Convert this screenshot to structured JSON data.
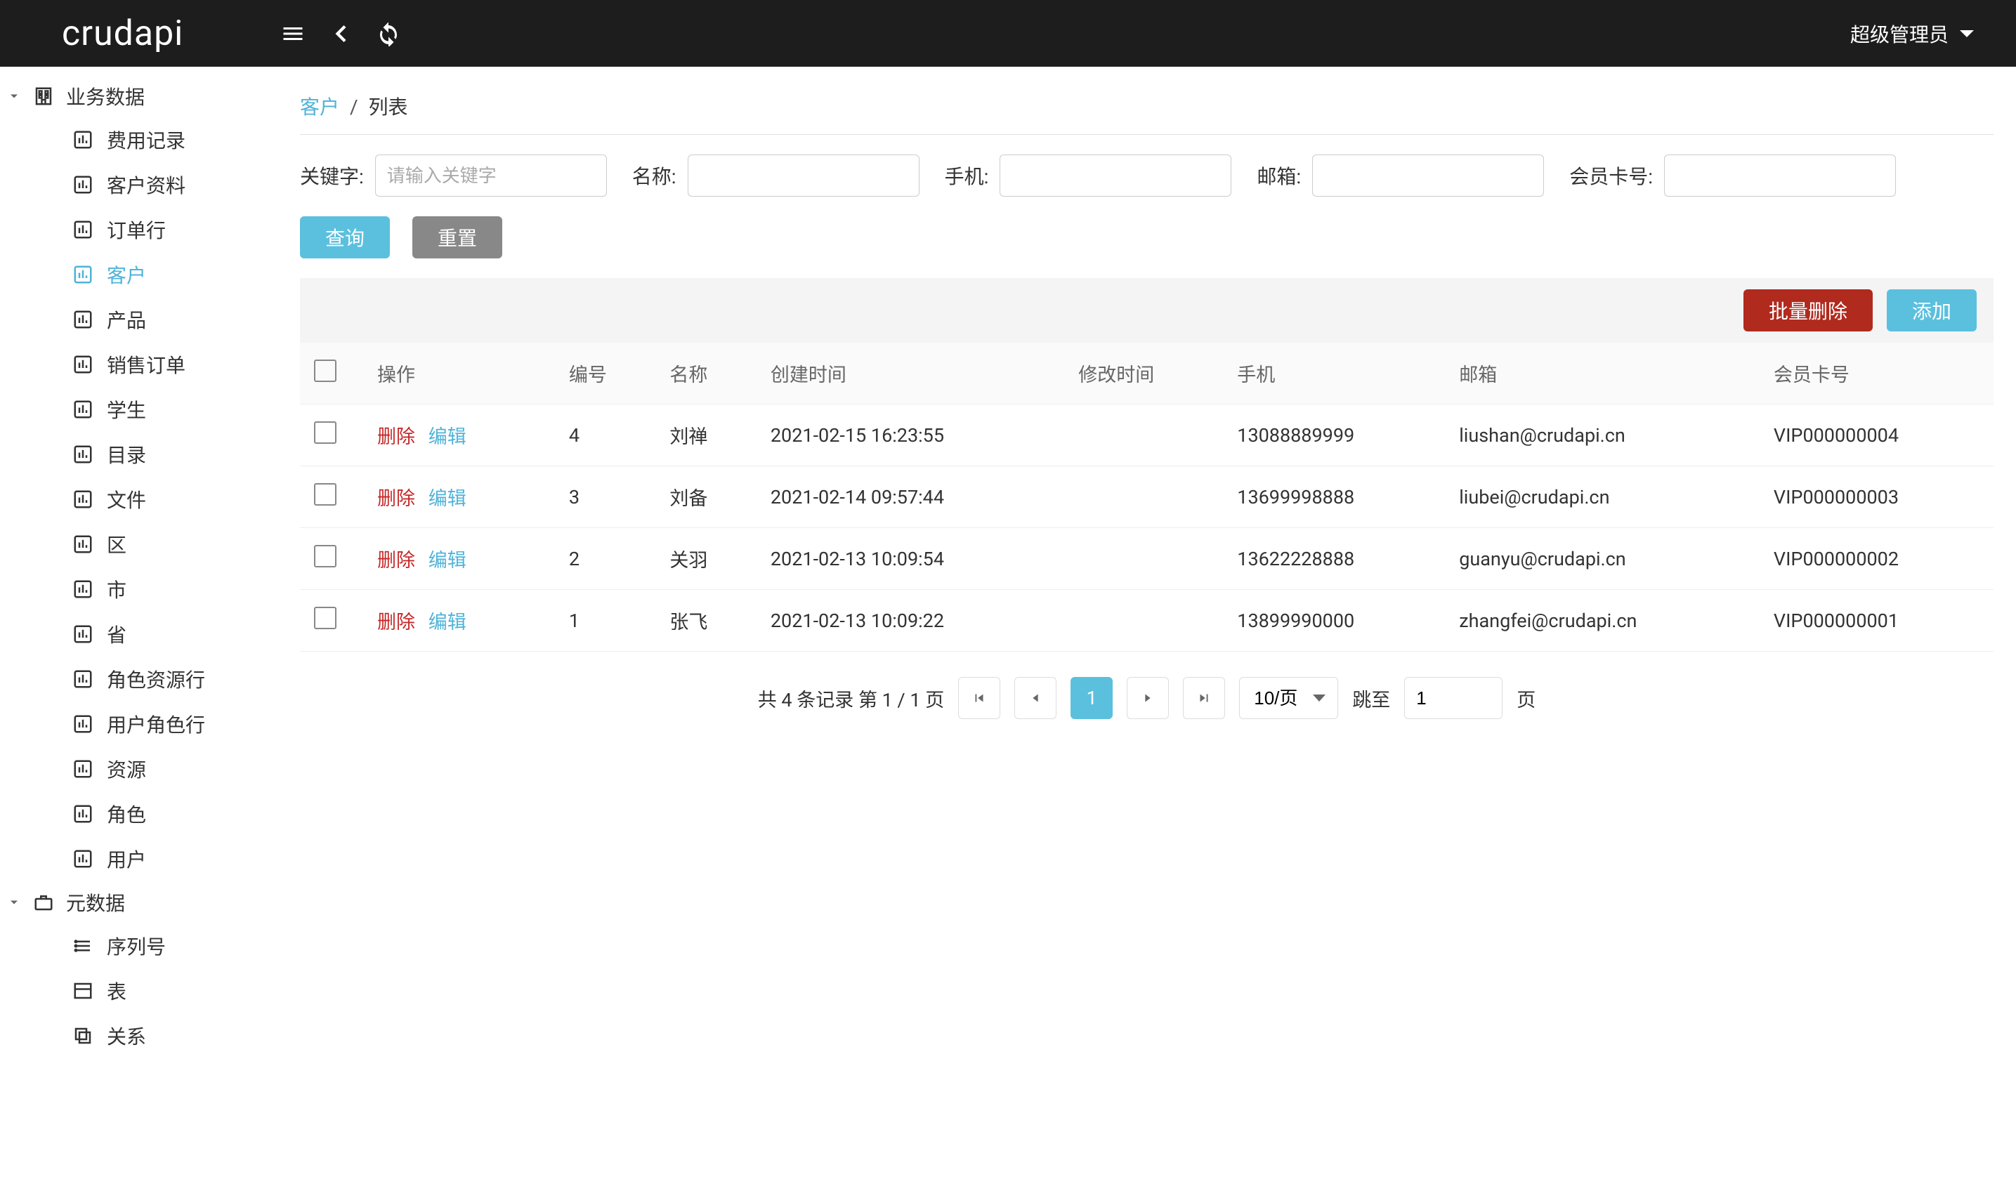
{
  "header": {
    "logo": "crudapi",
    "user": "超级管理员"
  },
  "sidebar": {
    "groups": [
      {
        "label": "业务数据",
        "icon": "building-icon",
        "expanded": true,
        "childIcon": "chart-icon",
        "children": [
          {
            "label": "费用记录",
            "active": false
          },
          {
            "label": "客户资料",
            "active": false
          },
          {
            "label": "订单行",
            "active": false
          },
          {
            "label": "客户",
            "active": true
          },
          {
            "label": "产品",
            "active": false
          },
          {
            "label": "销售订单",
            "active": false
          },
          {
            "label": "学生",
            "active": false
          },
          {
            "label": "目录",
            "active": false
          },
          {
            "label": "文件",
            "active": false
          },
          {
            "label": "区",
            "active": false
          },
          {
            "label": "市",
            "active": false
          },
          {
            "label": "省",
            "active": false
          },
          {
            "label": "角色资源行",
            "active": false
          },
          {
            "label": "用户角色行",
            "active": false
          },
          {
            "label": "资源",
            "active": false
          },
          {
            "label": "角色",
            "active": false
          },
          {
            "label": "用户",
            "active": false
          }
        ]
      },
      {
        "label": "元数据",
        "icon": "briefcase-icon",
        "expanded": true,
        "children": [
          {
            "label": "序列号",
            "icon": "list-icon",
            "active": false
          },
          {
            "label": "表",
            "icon": "table-icon",
            "active": false
          },
          {
            "label": "关系",
            "icon": "copy-icon",
            "active": false
          }
        ]
      }
    ]
  },
  "breadcrumb": {
    "link": "客户",
    "current": "列表"
  },
  "search": {
    "fields": [
      {
        "label": "关键字:",
        "placeholder": "请输入关键字",
        "value": ""
      },
      {
        "label": "名称:",
        "placeholder": "",
        "value": ""
      },
      {
        "label": "手机:",
        "placeholder": "",
        "value": ""
      },
      {
        "label": "邮箱:",
        "placeholder": "",
        "value": ""
      },
      {
        "label": "会员卡号:",
        "placeholder": "",
        "value": ""
      }
    ],
    "queryBtn": "查询",
    "resetBtn": "重置"
  },
  "toolbar": {
    "bulkDelete": "批量删除",
    "add": "添加"
  },
  "table": {
    "columns": [
      "",
      "操作",
      "编号",
      "名称",
      "创建时间",
      "修改时间",
      "手机",
      "邮箱",
      "会员卡号"
    ],
    "actions": {
      "delete": "删除",
      "edit": "编辑"
    },
    "rows": [
      {
        "id": "4",
        "name": "刘禅",
        "created": "2021-02-15 16:23:55",
        "modified": "",
        "phone": "13088889999",
        "email": "liushan@crudapi.cn",
        "card": "VIP000000004"
      },
      {
        "id": "3",
        "name": "刘备",
        "created": "2021-02-14 09:57:44",
        "modified": "",
        "phone": "13699998888",
        "email": "liubei@crudapi.cn",
        "card": "VIP000000003"
      },
      {
        "id": "2",
        "name": "关羽",
        "created": "2021-02-13 10:09:54",
        "modified": "",
        "phone": "13622228888",
        "email": "guanyu@crudapi.cn",
        "card": "VIP000000002"
      },
      {
        "id": "1",
        "name": "张飞",
        "created": "2021-02-13 10:09:22",
        "modified": "",
        "phone": "13899990000",
        "email": "zhangfei@crudapi.cn",
        "card": "VIP000000001"
      }
    ]
  },
  "pagination": {
    "summary": "共 4 条记录 第 1 / 1 页",
    "pageSize": "10/页",
    "jumpLabel": "跳至",
    "jumpValue": "1",
    "jumpSuffix": "页",
    "current": "1"
  }
}
